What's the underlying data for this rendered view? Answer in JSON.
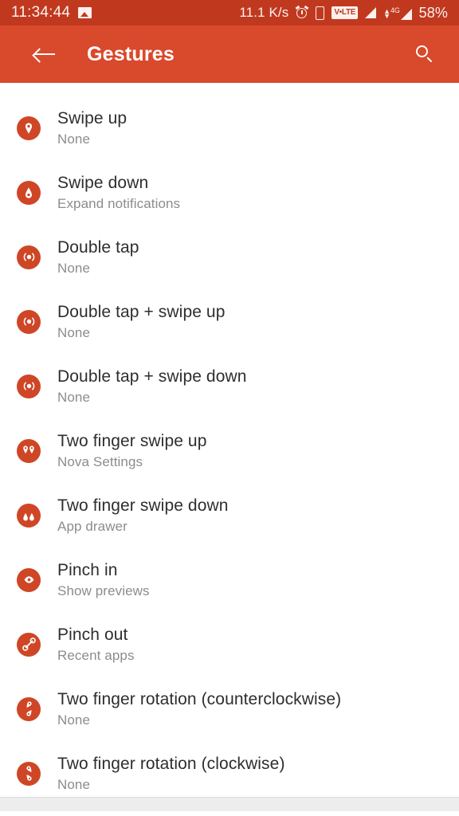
{
  "status_bar": {
    "clock": "11:34:44",
    "left_icons": [
      "image-icon"
    ],
    "network_speed": "11.1 K/s",
    "right_icons": [
      "alarm-icon",
      "sim-card-icon",
      "volte-icon",
      "signal-bars-icon",
      "data-arrows-icon",
      "signal-4g-icon"
    ],
    "volte_label": "V•LTE",
    "network_type": "4G",
    "battery": "58%",
    "background_color": "#c0391f"
  },
  "app_bar": {
    "back_label": "back-arrow",
    "title": "Gestures",
    "search_label": "search-icon",
    "background_color": "#d9492b"
  },
  "theme": {
    "accent": "#cf4626",
    "title_color": "#2e2e2e",
    "subtitle_color": "#8c8c8c"
  },
  "gestures": [
    {
      "icon": "swipe-up-icon",
      "title": "Swipe up",
      "value": "None"
    },
    {
      "icon": "swipe-down-icon",
      "title": "Swipe down",
      "value": "Expand notifications"
    },
    {
      "icon": "double-tap-icon",
      "title": "Double tap",
      "value": "None"
    },
    {
      "icon": "double-tap-swipe-up-icon",
      "title": "Double tap + swipe up",
      "value": "None"
    },
    {
      "icon": "double-tap-swipe-down-icon",
      "title": "Double tap + swipe down",
      "value": "None"
    },
    {
      "icon": "two-finger-swipe-up-icon",
      "title": "Two finger swipe up",
      "value": "Nova Settings"
    },
    {
      "icon": "two-finger-swipe-down-icon",
      "title": "Two finger swipe down",
      "value": "App drawer"
    },
    {
      "icon": "pinch-in-icon",
      "title": "Pinch in",
      "value": "Show previews"
    },
    {
      "icon": "pinch-out-icon",
      "title": "Pinch out",
      "value": "Recent apps"
    },
    {
      "icon": "rotate-ccw-icon",
      "title": "Two finger rotation (counterclockwise)",
      "value": "None"
    },
    {
      "icon": "rotate-cw-icon",
      "title": "Two finger rotation (clockwise)",
      "value": "None"
    }
  ]
}
